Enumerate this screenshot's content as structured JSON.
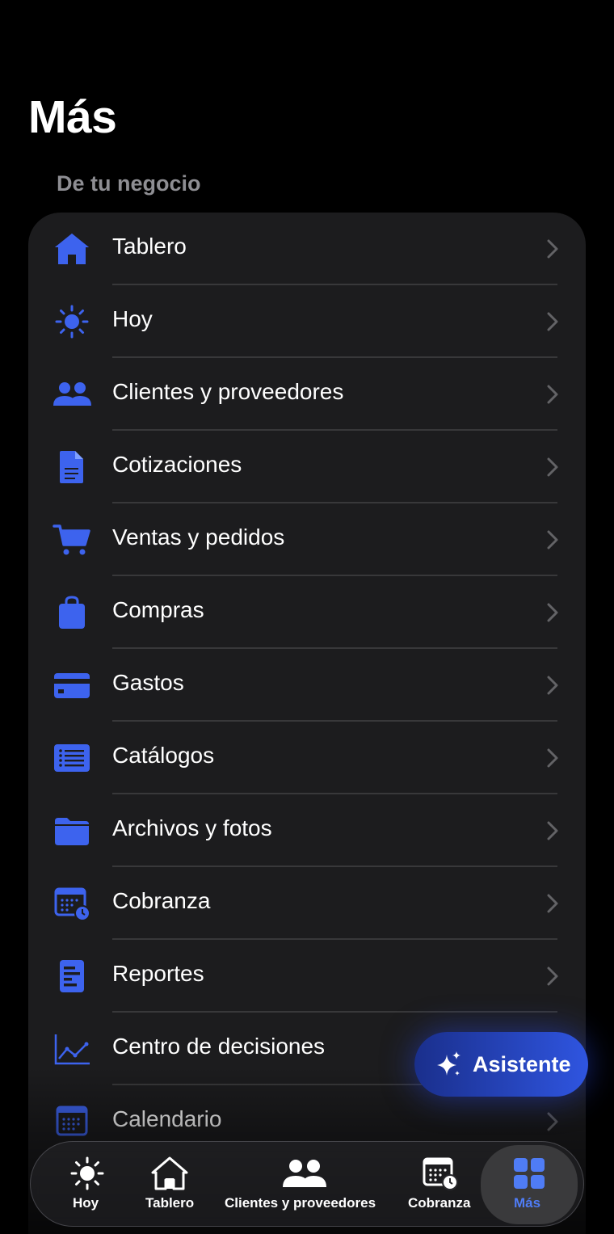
{
  "header": {
    "title": "Más"
  },
  "section": {
    "title": "De tu negocio"
  },
  "menu": {
    "items": [
      {
        "label": "Tablero",
        "icon": "house-icon"
      },
      {
        "label": "Hoy",
        "icon": "sun-icon"
      },
      {
        "label": "Clientes y proveedores",
        "icon": "people-icon"
      },
      {
        "label": "Cotizaciones",
        "icon": "document-icon"
      },
      {
        "label": "Ventas y pedidos",
        "icon": "cart-icon"
      },
      {
        "label": "Compras",
        "icon": "bag-icon"
      },
      {
        "label": "Gastos",
        "icon": "credit-card-icon"
      },
      {
        "label": "Catálogos",
        "icon": "list-icon"
      },
      {
        "label": "Archivos y fotos",
        "icon": "folder-icon"
      },
      {
        "label": "Cobranza",
        "icon": "calendar-clock-icon"
      },
      {
        "label": "Reportes",
        "icon": "report-icon"
      },
      {
        "label": "Centro de decisiones",
        "icon": "chart-line-icon"
      },
      {
        "label": "Calendario",
        "icon": "calendar-icon"
      }
    ]
  },
  "assistant": {
    "label": "Asistente",
    "icon": "sparkles-icon"
  },
  "tabbar": {
    "tabs": [
      {
        "label": "Hoy",
        "icon": "sun-icon",
        "active": false
      },
      {
        "label": "Tablero",
        "icon": "house-icon",
        "active": false
      },
      {
        "label": "Clientes y proveedores",
        "icon": "people-icon",
        "active": false
      },
      {
        "label": "Cobranza",
        "icon": "calendar-clock-icon",
        "active": false
      },
      {
        "label": "Más",
        "icon": "grid-icon",
        "active": true
      }
    ]
  },
  "colors": {
    "accent": "#3d63ee",
    "background": "#000000",
    "card": "#1c1c1e",
    "active_tab_label": "#4f7cf5"
  }
}
